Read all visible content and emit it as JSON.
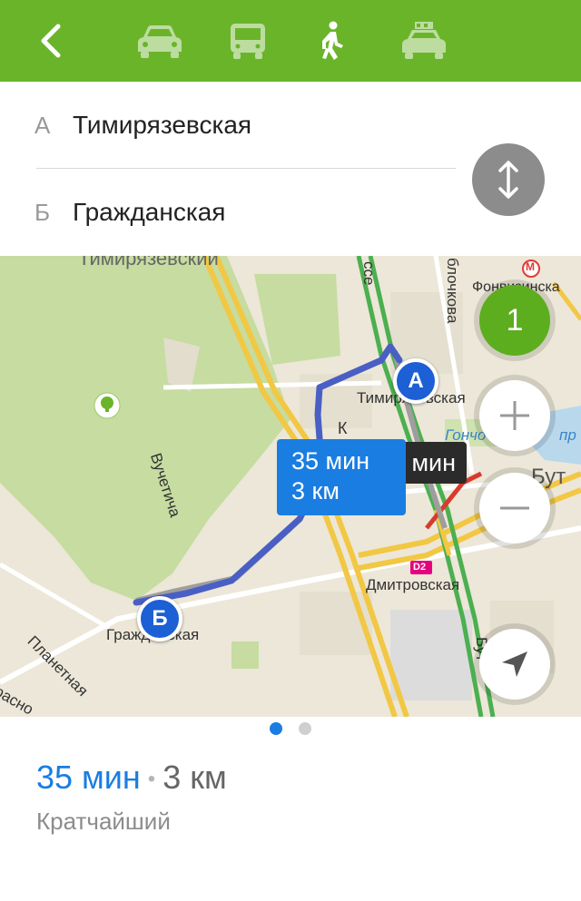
{
  "header": {
    "back_icon": "chevron-left-icon",
    "modes": [
      {
        "name": "car",
        "icon": "car-icon"
      },
      {
        "name": "bus",
        "icon": "bus-icon"
      },
      {
        "name": "walk",
        "icon": "pedestrian-icon",
        "active": true
      },
      {
        "name": "taxi",
        "icon": "taxi-icon"
      }
    ],
    "color": "#6ab42a"
  },
  "route_inputs": {
    "from": {
      "letter": "А",
      "value": "Тимирязевская"
    },
    "to": {
      "letter": "Б",
      "value": "Гражданская"
    },
    "swap_icon": "swap-vertical-icon"
  },
  "map": {
    "labels": {
      "district": "Тимирязевский",
      "street_vuchetich": "Вучетича",
      "street_blochkova": "блочкова",
      "street_fonvizinskaya": "Фонвизинска",
      "street_shosse": "ссе",
      "station_timiryazevskaya": "Тимирязевская",
      "station_dmitrovskaya": "Дмитровская",
      "station_grazhdanskaya": "Гражданская",
      "street_planetnaya": "Планетная",
      "street_krasno": "расно",
      "pond": "Гончо",
      "pond2": "пр",
      "buty": "Бут",
      "buty2": "Бут",
      "k_label": "К",
      "d2_badge": "D2",
      "metro_badge": "М"
    },
    "alt_route_callout": "мин",
    "route_callout": {
      "time": "35 мин",
      "distance": "3 км"
    },
    "marker_a": "А",
    "marker_b": "Б",
    "route_count": "1",
    "zoom_in_icon": "plus-icon",
    "zoom_out_icon": "minus-icon",
    "locate_icon": "location-arrow-icon"
  },
  "pager": {
    "total": 2,
    "active": 0
  },
  "summary": {
    "time": "35 мин",
    "separator": "•",
    "distance": "3 км",
    "type": "Кратчайший"
  },
  "colors": {
    "accent": "#1a7de2",
    "route": "#4a5fc4",
    "green": "#6ab42a"
  }
}
